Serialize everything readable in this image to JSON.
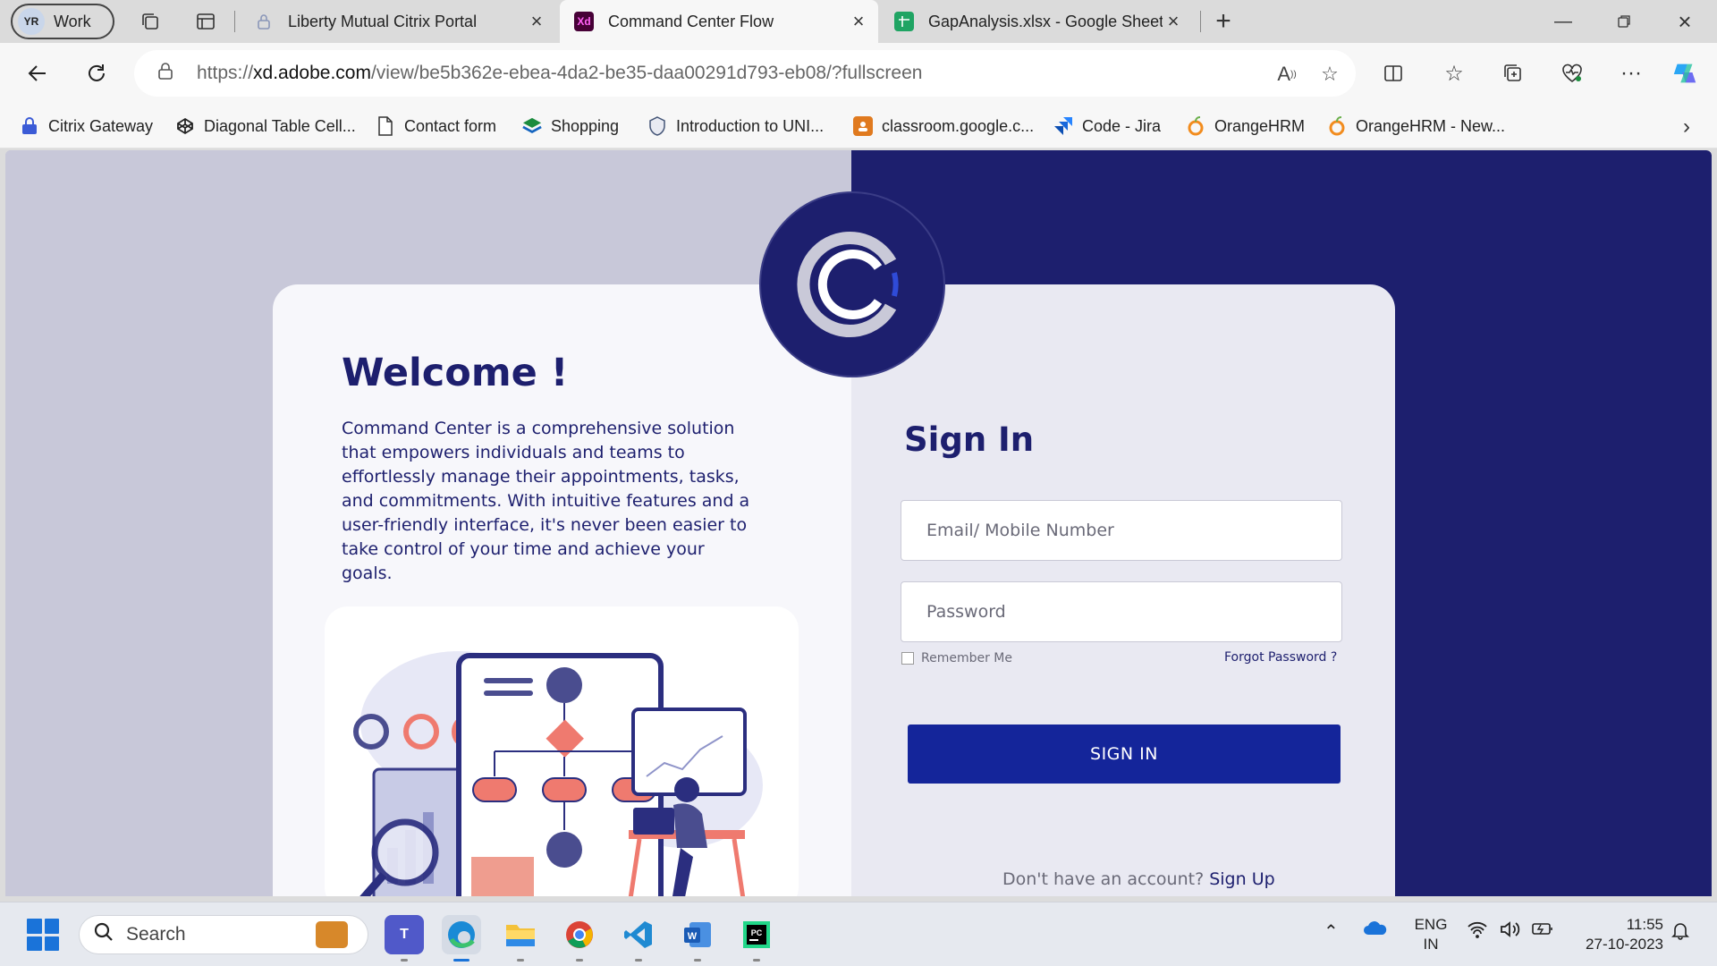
{
  "profile": {
    "initials": "YR",
    "label": "Work"
  },
  "tabs": [
    {
      "title": "Liberty Mutual Citrix Portal",
      "favicon": "lock-icon"
    },
    {
      "title": "Command Center Flow",
      "favicon": "xd-icon",
      "favicon_text": "Xd",
      "active": true
    },
    {
      "title": "GapAnalysis.xlsx - Google Sheets",
      "favicon": "sheets-icon"
    }
  ],
  "address_bar": {
    "url_prefix": "https://",
    "url_host": "xd.adobe.com",
    "url_path": "/view/be5b362e-ebea-4da2-be35-daa00291d793-eb08/?fullscreen"
  },
  "bookmarks": [
    {
      "label": "Citrix Gateway",
      "icon": "citrix-icon",
      "color": "#3b5bd6"
    },
    {
      "label": "Diagonal Table Cell...",
      "icon": "codepen-icon",
      "color": "#222222"
    },
    {
      "label": "Contact form",
      "icon": "document-icon",
      "color": "#ffffff"
    },
    {
      "label": "Shopping",
      "icon": "stack-icon",
      "color": "#1c8c3e"
    },
    {
      "label": "Introduction to UNI...",
      "icon": "shield-icon",
      "color": "#445577"
    },
    {
      "label": "classroom.google.c...",
      "icon": "classroom-icon",
      "color": "#e07a1f"
    },
    {
      "label": "Code - Jira",
      "icon": "jira-icon",
      "color": "#2684ff"
    },
    {
      "label": "OrangeHRM",
      "icon": "orangehrm-icon",
      "color": "#f28c1e"
    },
    {
      "label": "OrangeHRM - New...",
      "icon": "orangehrm-icon",
      "color": "#f28c1e"
    }
  ],
  "page": {
    "welcome_title": "Welcome !",
    "description": "Command Center is a comprehensive solution that empowers individuals and teams to effortlessly manage their appointments, tasks, and commitments. With intuitive features and a user-friendly interface, it's never been easier to take control of your time and achieve your goals.",
    "signin_title": "Sign In",
    "email_placeholder": "Email/ Mobile Number",
    "password_placeholder": "Password",
    "remember_label": "Remember Me",
    "forgot_label": "Forgot Password ?",
    "signin_button": "SIGN IN",
    "signup_prompt": "Don't  have an account?",
    "signup_link": "Sign Up",
    "colors": {
      "navy": "#1d1f6e",
      "button": "#14259a",
      "left_bg": "#c8c8d9"
    }
  },
  "taskbar": {
    "search_label": "Search",
    "apps": [
      "teams-icon",
      "edge-icon",
      "file-explorer-icon",
      "chrome-icon",
      "vscode-icon",
      "word-icon",
      "pycharm-icon"
    ],
    "lang_line1": "ENG",
    "lang_line2": "IN",
    "time": "11:55",
    "date": "27-10-2023"
  }
}
